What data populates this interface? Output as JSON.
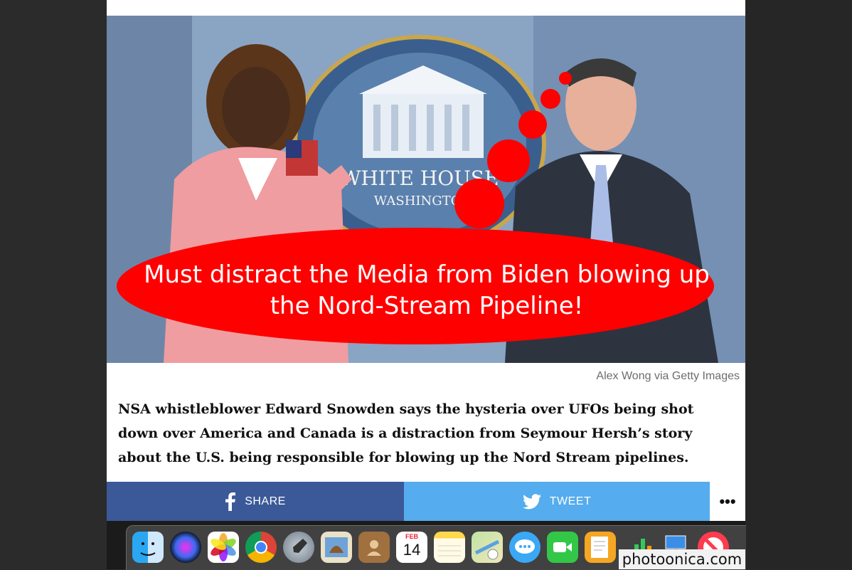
{
  "meme": {
    "bubble_text": "Must distract the Media from Biden blowing up the Nord-Stream Pipeline!",
    "sign_line1": "WHITE HOUSE",
    "sign_line2": "WASHINGTON"
  },
  "caption": {
    "credit": "Alex Wong via Getty Images"
  },
  "article": {
    "lede": "NSA whistleblower Edward Snowden says the hysteria over UFOs being shot down over America and Canada is a distraction from Seymour Hersh’s story about the U.S. being responsible for blowing up the Nord Stream pipelines."
  },
  "share_bar": {
    "share_label": "SHARE",
    "tweet_label": "TWEET",
    "more_label": "•••",
    "colors": {
      "facebook": "#3b5998",
      "twitter": "#55acee"
    }
  },
  "dock": {
    "items": [
      {
        "name": "finder-icon"
      },
      {
        "name": "siri-icon"
      },
      {
        "name": "photos-icon"
      },
      {
        "name": "chrome-icon"
      },
      {
        "name": "launchpad-icon"
      },
      {
        "name": "mail-icon"
      },
      {
        "name": "contacts-icon"
      },
      {
        "name": "calendar-icon",
        "month": "FEB",
        "day": "14"
      },
      {
        "name": "notes-icon"
      },
      {
        "name": "maps-icon"
      },
      {
        "name": "messages-icon"
      },
      {
        "name": "facetime-icon"
      },
      {
        "name": "pages-icon"
      },
      {
        "name": "numbers-icon"
      },
      {
        "name": "keynote-icon"
      },
      {
        "name": "news-icon"
      }
    ]
  },
  "watermark": {
    "text": "photoonica.com"
  }
}
